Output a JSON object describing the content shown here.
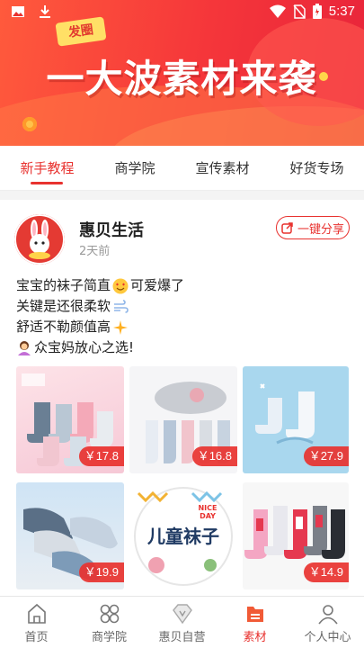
{
  "status_bar": {
    "time": "5:37",
    "icons": [
      "image-icon",
      "download-icon",
      "wifi-icon",
      "no-sim-icon",
      "battery-icon"
    ]
  },
  "banner": {
    "tag": "发圈",
    "title": "一大波素材来袭"
  },
  "tabs": [
    {
      "label": "新手教程",
      "active": true
    },
    {
      "label": "商学院",
      "active": false
    },
    {
      "label": "宣传素材",
      "active": false
    },
    {
      "label": "好货专场",
      "active": false
    }
  ],
  "post": {
    "author": "惠贝生活",
    "time_ago": "2天前",
    "share_label": "一键分享",
    "text_lines": [
      "宝宝的袜子简直",
      "可爱爆了",
      "关键是还很柔软",
      "舒适不勒颜值高",
      "众宝妈放心之选!"
    ],
    "images": [
      {
        "price": "￥17.8"
      },
      {
        "price": "￥16.8"
      },
      {
        "price": "￥27.9"
      },
      {
        "price": "￥19.9"
      },
      {
        "label": "儿童袜子",
        "badge": "NICE DAY"
      },
      {
        "price": "￥14.9"
      }
    ]
  },
  "bottom_nav": [
    {
      "label": "首页",
      "icon": "home-icon",
      "active": false
    },
    {
      "label": "商学院",
      "icon": "grid-icon",
      "active": false
    },
    {
      "label": "惠贝自营",
      "icon": "diamond-icon",
      "active": false
    },
    {
      "label": "素材",
      "icon": "material-icon",
      "active": true
    },
    {
      "label": "个人中心",
      "icon": "person-icon",
      "active": false
    }
  ],
  "colors": {
    "accent": "#e8322f",
    "banner": "#f5363a"
  }
}
